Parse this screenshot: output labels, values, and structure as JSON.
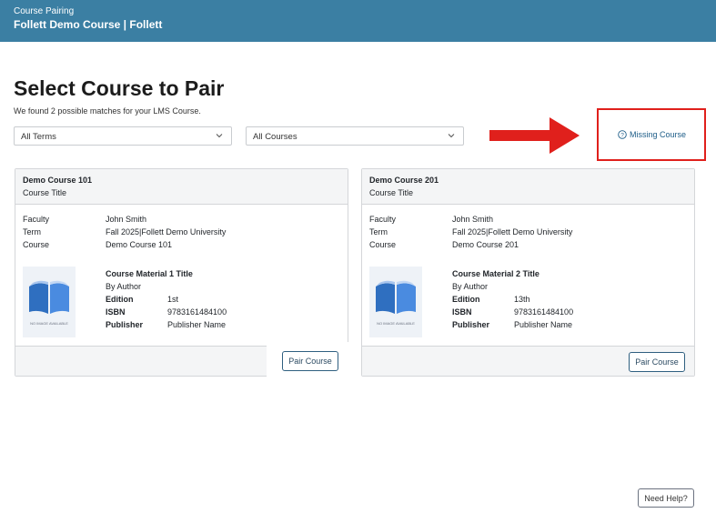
{
  "header": {
    "subtitle": "Course Pairing",
    "title": "Follett Demo Course | Follett"
  },
  "page": {
    "title": "Select Course to Pair",
    "match_text": "We found 2 possible matches for your LMS Course."
  },
  "filters": {
    "terms_value": "All Terms",
    "courses_value": "All Courses"
  },
  "missing_course": {
    "label": "Missing Course"
  },
  "labels": {
    "faculty": "Faculty",
    "term": "Term",
    "course": "Course",
    "by": "By Author",
    "edition": "Edition",
    "isbn": "ISBN",
    "publisher": "Publisher",
    "no_image": "NO IMAGE AVAILABLE"
  },
  "cards": [
    {
      "name": "Demo Course 101",
      "subtitle": "Course Title",
      "faculty": "John Smith",
      "term": "Fall 2025|Follett Demo University",
      "course": "Demo Course 101",
      "material_title": "Course Material 1 Title",
      "edition": "1st",
      "isbn": "9783161484100",
      "publisher": "Publisher Name",
      "button": "Pair Course"
    },
    {
      "name": "Demo Course 201",
      "subtitle": "Course Title",
      "faculty": "John Smith",
      "term": "Fall 2025|Follett Demo University",
      "course": "Demo Course 201",
      "material_title": "Course Material 2 Title",
      "edition": "13th",
      "isbn": "9783161484100",
      "publisher": "Publisher Name",
      "button": "Pair Course"
    }
  ],
  "help": {
    "label": "Need Help?"
  },
  "colors": {
    "header": "#3b7fa3",
    "arrow": "#e0201c",
    "link": "#1d5d88"
  }
}
